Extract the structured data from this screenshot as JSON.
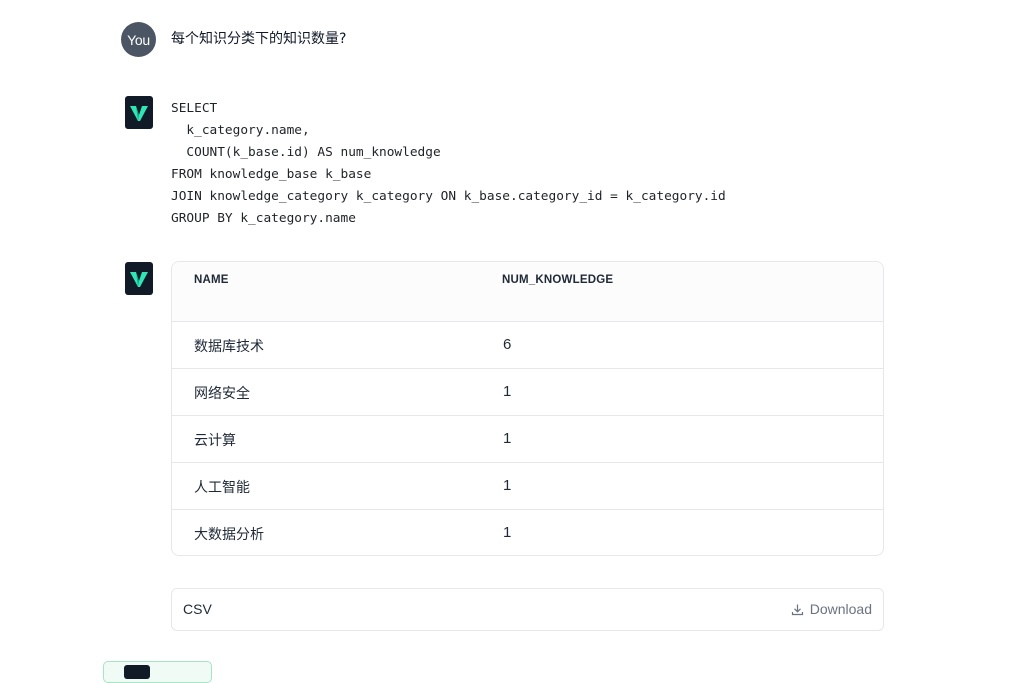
{
  "user": {
    "avatar_label": "You",
    "question": "每个知识分类下的知识数量?"
  },
  "assistant": {
    "sql": "SELECT\n  k_category.name,\n  COUNT(k_base.id) AS num_knowledge\nFROM knowledge_base k_base\nJOIN knowledge_category k_category ON k_base.category_id = k_category.id\nGROUP BY k_category.name"
  },
  "result_table": {
    "columns": [
      "NAME",
      "NUM_KNOWLEDGE"
    ],
    "rows": [
      [
        "数据库技术",
        "6"
      ],
      [
        "网络安全",
        "1"
      ],
      [
        "云计算",
        "1"
      ],
      [
        "人工智能",
        "1"
      ],
      [
        "大数据分析",
        "1"
      ]
    ]
  },
  "export": {
    "format_label": "CSV",
    "download_label": "Download"
  },
  "colors": {
    "bot_logo_bg": "#111b27",
    "bot_logo_accent": "#2ee6b6",
    "user_avatar_bg": "#4b5563"
  },
  "icons": {
    "bot": "vanna-logo-icon",
    "download": "download-icon"
  }
}
